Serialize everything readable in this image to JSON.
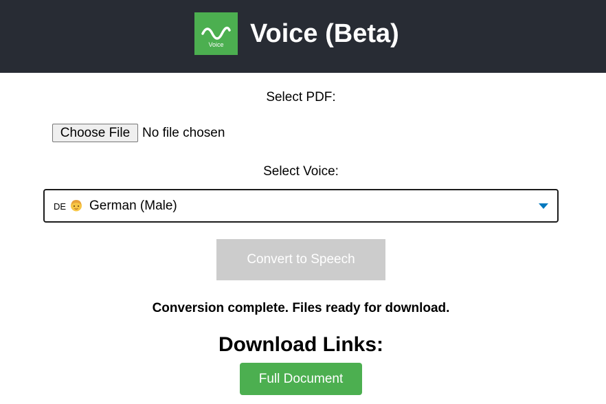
{
  "header": {
    "title": "Voice (Beta)",
    "logo_text": "Voice",
    "background_color": "#282c34",
    "logo_color": "#4caf50"
  },
  "pdf_section": {
    "label": "Select PDF:",
    "choose_button_label": "Choose File",
    "file_status": "No file chosen"
  },
  "voice_section": {
    "label": "Select Voice:",
    "selected": {
      "flag_code": "DE",
      "icon": "man-face-icon",
      "label": "German (Male)"
    }
  },
  "convert_button_label": "Convert to Speech",
  "status_message": "Conversion complete. Files ready for download.",
  "downloads": {
    "heading": "Download Links:",
    "links": [
      {
        "label": "Full Document"
      }
    ]
  }
}
